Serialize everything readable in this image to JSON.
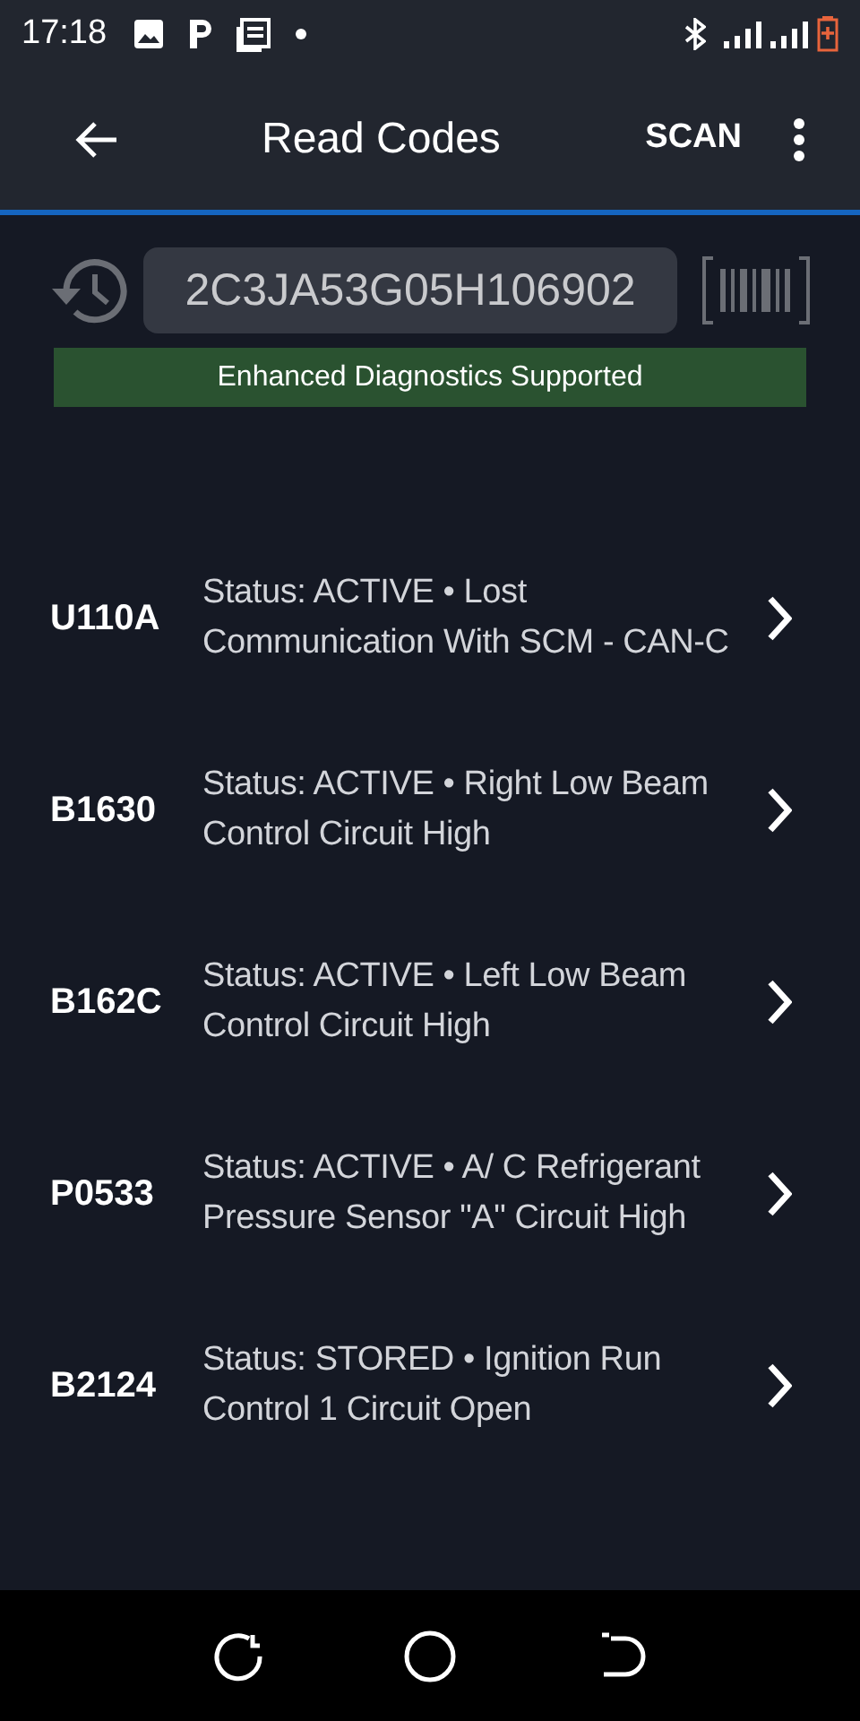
{
  "status_bar": {
    "time": "17:18"
  },
  "header": {
    "title": "Read Codes",
    "action": "SCAN"
  },
  "vin_field": {
    "value": "2C3JA53G05H106902"
  },
  "banner": "Enhanced Diagnostics Supported",
  "codes": [
    {
      "code": "U110A",
      "description": "Status: ACTIVE • Lost Communication With SCM - CAN-C"
    },
    {
      "code": "B1630",
      "description": "Status: ACTIVE • Right Low Beam Control Circuit High"
    },
    {
      "code": "B162C",
      "description": "Status: ACTIVE • Left Low Beam Control Circuit High"
    },
    {
      "code": "P0533",
      "description": "Status: ACTIVE • A/ C Refrigerant Pressure Sensor \"A\" Circuit High"
    },
    {
      "code": "B2124",
      "description": "Status: STORED • Ignition Run Control 1 Circuit Open"
    }
  ]
}
